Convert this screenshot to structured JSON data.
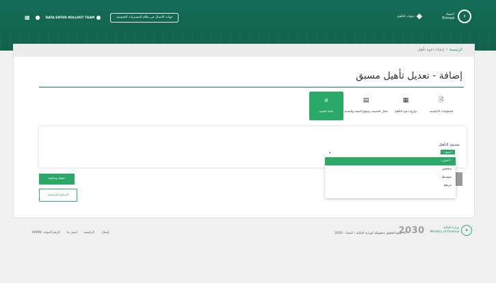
{
  "header": {
    "grid_icon": "grid-icon",
    "bell_icon": "bell-icon",
    "user_name": "DATA ENTER ROLLOUT TEAM",
    "switch_button": "جهات الاتصال في نظام المشتريات العمومية",
    "invitations_link": "دعوات التأهيل",
    "brand_ar": "اعتماد",
    "brand_en": "Etimad"
  },
  "breadcrumb": {
    "home": "الرئيسية",
    "separator": "/",
    "current": "إنشاء دعوة تأهيل"
  },
  "page": {
    "title": "إضافة - تعديل تأهيل مسبق"
  },
  "steps": [
    {
      "label": "المعلومات الأساسية",
      "icon": "document-icon",
      "active": false
    },
    {
      "label": "تواريخ دعوة التأهيل",
      "icon": "calendar-icon",
      "active": false
    },
    {
      "label": "مجال التصنيف وموقع التنفيذ والتقديم",
      "icon": "table-icon",
      "active": false
    },
    {
      "label": "نقاط التقييم",
      "icon": "paperclip-icon",
      "active": true
    }
  ],
  "form": {
    "level_label": "مستوى التأهيل",
    "level_selected": "--اختيار--"
  },
  "dropdown": {
    "options": [
      "--اختيار--",
      "منخفض",
      "متوسط",
      "مرتفع"
    ]
  },
  "buttons": {
    "add_save": "حفظ ومتابعة",
    "back_home": "الرجوع للرئيسية"
  },
  "footer": {
    "links": [
      "إتصال",
      "الرئيسية",
      "إتصل بنا",
      "الرقم الموحد :19990"
    ],
    "copyright": "© جميع الحقوق محفوظة لوزارة المالية - اعتماد - 2020",
    "vision": "2030",
    "ministry_ar": "وزارة المالية",
    "ministry_en": "Ministry of Finance"
  },
  "colors": {
    "header": "#136a55",
    "accent": "#2aa866",
    "rule": "#0f7a59"
  }
}
